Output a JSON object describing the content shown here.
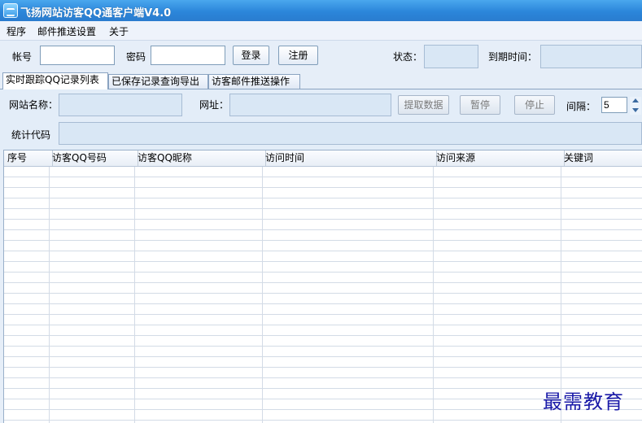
{
  "window": {
    "title": "飞扬网站访客QQ通客户端V4.0"
  },
  "menu": {
    "items": [
      "程序",
      "邮件推送设置",
      "关于"
    ]
  },
  "login": {
    "account_label": "帐号",
    "account_value": "",
    "password_label": "密码",
    "password_value": "",
    "login_button": "登录",
    "register_button": "注册",
    "status_label": "状态：",
    "status_value": "",
    "expiry_label": "到期时间：",
    "expiry_value": ""
  },
  "tabs": [
    {
      "label": "实时跟踪QQ记录列表",
      "active": true
    },
    {
      "label": "已保存记录查询导出",
      "active": false
    },
    {
      "label": "访客邮件推送操作",
      "active": false
    }
  ],
  "panel": {
    "site_name_label": "网站名称：",
    "site_name_value": "",
    "url_label": "网址：",
    "url_value": "",
    "fetch_button": "提取数据",
    "pause_button": "暂停",
    "stop_button": "停止",
    "interval_label": "间隔：",
    "interval_value": "5",
    "stat_code_label": "统计代码",
    "stat_code_value": ""
  },
  "table": {
    "columns": [
      "序号",
      "访客QQ号码",
      "访客QQ昵称",
      "访问时间",
      "访问来源",
      "关键词"
    ],
    "rows": []
  },
  "watermark": "最需教育",
  "colors": {
    "titlebar": "#2b86da",
    "panel": "#e3edf8",
    "watermark": "#1a1aa8"
  }
}
